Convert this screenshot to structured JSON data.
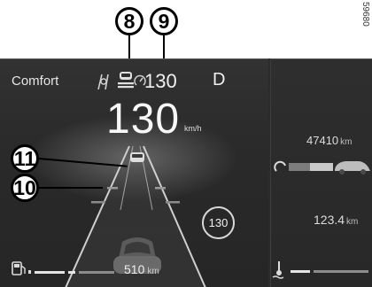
{
  "callouts": {
    "c8": "8",
    "c9": "9",
    "c10": "10",
    "c11": "11"
  },
  "reference_code": "59680",
  "top_bar": {
    "drive_mode": "Comfort",
    "set_speed": "130",
    "gear": "D"
  },
  "speed": {
    "value": "130",
    "unit": "km/h"
  },
  "speed_limit_sign": "130",
  "fuel": {
    "range_value": "510",
    "range_unit": "km",
    "icon": "fuel-pump-icon"
  },
  "side_panel": {
    "odometer_value": "47410",
    "odometer_unit": "km",
    "trip_value": "123.4",
    "trip_unit": "km",
    "icon_trip": "car-distance-icon",
    "icon_temp": "coolant-temperature-icon"
  },
  "icons": {
    "lane_keep": "lane-keeping-icon",
    "cruise": "adaptive-cruise-car-icon",
    "speed_limiter": "speedometer-icon"
  },
  "colors": {
    "panel_dark": "#2b2b2b",
    "text_light": "#e6e6e6",
    "callout": "#000000"
  }
}
